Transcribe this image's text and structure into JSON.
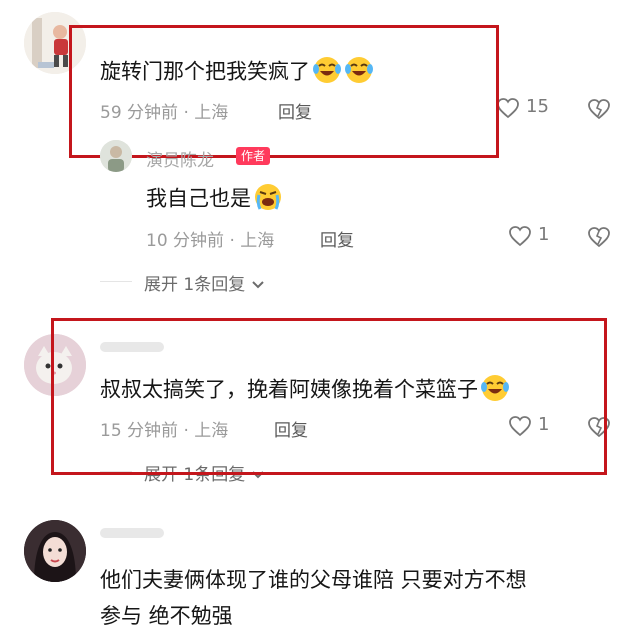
{
  "comments": [
    {
      "text": "旋转门那个把我笑疯了",
      "time": "59 分钟前 · 上海",
      "reply_label": "回复",
      "likes": "15"
    },
    {
      "author": "演员陈龙",
      "badge": "作者",
      "text": "我自己也是",
      "time": "10 分钟前 · 上海",
      "reply_label": "回复",
      "likes": "1",
      "expand": "展开 1条回复"
    },
    {
      "text": "叔叔太搞笑了，挽着阿姨像挽着个菜篮子",
      "time": "15 分钟前 · 上海",
      "reply_label": "回复",
      "likes": "1",
      "expand": "展开 1条回复"
    },
    {
      "text_line1": "他们夫妻俩体现了谁的父母谁陪  只要对方不想",
      "text_line2": "参与  绝不勉强"
    }
  ],
  "icons": {
    "like": "heart-outline-icon",
    "dislike": "broken-heart-icon",
    "expand_chevron": "chevron-down-icon",
    "emoji_laugh": "laughing-crying-emoji-icon",
    "emoji_cry": "crying-emoji-icon"
  },
  "colors": {
    "highlight": "#c4161c",
    "badge": "#ff3a5c",
    "meta": "#9a9a9a"
  }
}
